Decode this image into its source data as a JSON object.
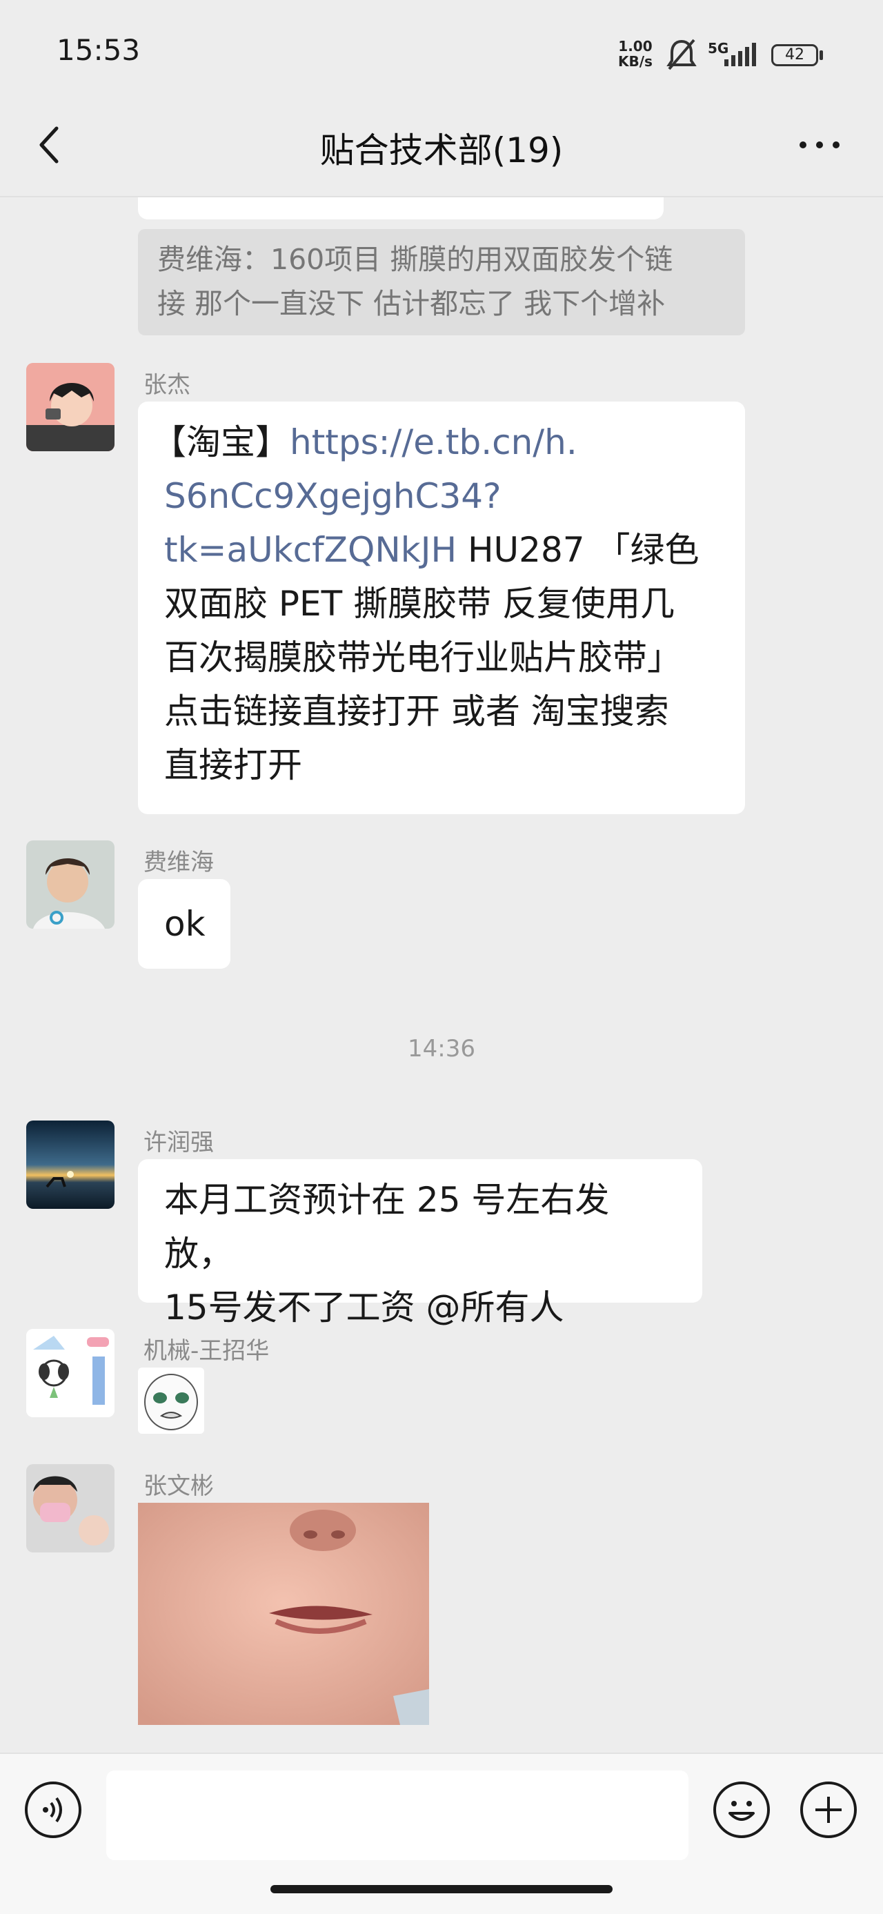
{
  "status_bar": {
    "time": "15:53",
    "net_speed_value": "1.00",
    "net_speed_unit": "KB/s",
    "network": "5G",
    "battery": "42",
    "icons": [
      "mute-bell-icon",
      "signal-icon",
      "battery-icon"
    ]
  },
  "header": {
    "title": "贴合技术部(19)",
    "back_icon": "chevron-left-icon",
    "more_icon": "more-dots-icon"
  },
  "messages": {
    "quote": {
      "line1": "费维海：160项目 撕膜的用双面胶发个链",
      "line2": "接 那个一直没下 估计都忘了 我下个增补"
    },
    "zhangjie": {
      "sender": "张杰",
      "line1_prefix": "【淘宝】",
      "link1": "https://e.tb.cn/h.",
      "link2": "S6nCc9XgejghC34?",
      "link3": "tk=aUkcfZQNkJH",
      "line3_suffix": " HU287 「绿色",
      "line4": "双面胶 PET 撕膜胶带 反复使用几",
      "line5": "百次揭膜胶带光电行业贴片胶带」",
      "line6": "点击链接直接打开 或者 淘宝搜索",
      "line7": "直接打开"
    },
    "feiweihai": {
      "sender": "费维海",
      "text": "ok"
    },
    "time_separator": "14:36",
    "xurunqiang": {
      "sender": "许润强",
      "line1": "本月工资预计在 25 号左右发放，",
      "line2": "15号发不了工资 @所有人"
    },
    "wangzhaohua": {
      "sender": "机械-王招华",
      "content": "sticker"
    },
    "zhangwenbin": {
      "sender": "张文彬",
      "content": "photo"
    }
  },
  "bottom_bar": {
    "voice_icon": "voice-icon",
    "emoji_icon": "emoji-icon",
    "add_icon": "plus-icon",
    "input_value": ""
  }
}
